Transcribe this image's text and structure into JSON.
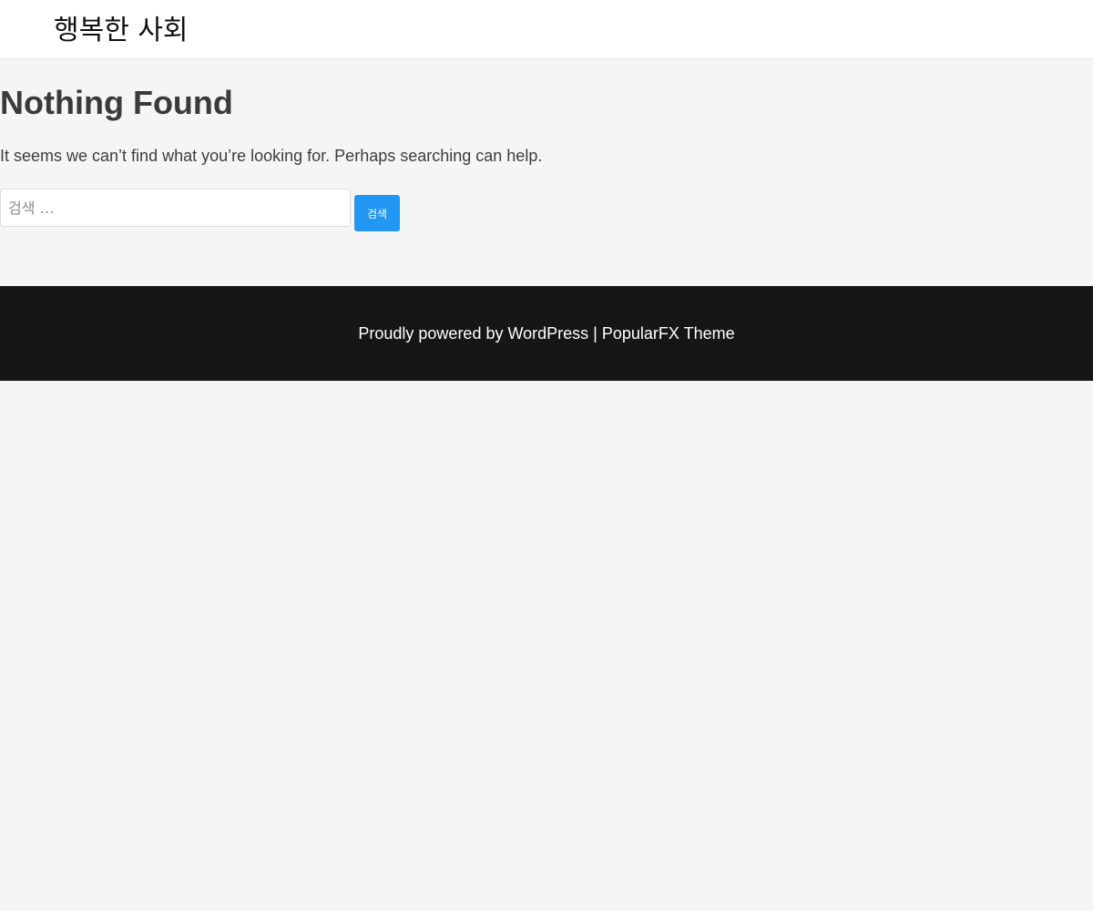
{
  "header": {
    "site_title": "행복한 사회"
  },
  "main": {
    "title": "Nothing Found",
    "message": "It seems we can’t find what you’re looking for. Perhaps searching can help.",
    "search": {
      "value": "",
      "placeholder": "검색 …",
      "button_label": "검색"
    }
  },
  "footer": {
    "powered_prefix": "Proudly powered by ",
    "wordpress_link": "WordPress",
    "separator": " | ",
    "theme_link": "PopularFX Theme"
  },
  "colors": {
    "background": "#f5f5f5",
    "header_background": "#ffffff",
    "footer_background": "#161616",
    "accent": "#2196f3"
  }
}
